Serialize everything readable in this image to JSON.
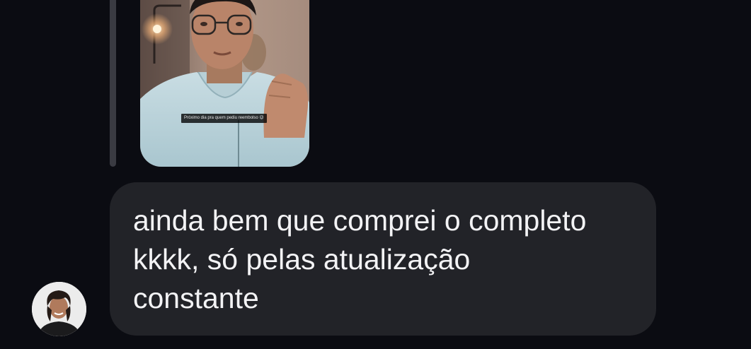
{
  "media": {
    "caption": "Próximo dia pra quem pediu reembolso 😉",
    "icon": "video-thumbnail"
  },
  "message": {
    "lines": [
      "ainda bem que comprei o completo",
      "kkkk, só pelas atualização",
      "constante"
    ]
  },
  "sender": {
    "avatar_icon": "user-avatar"
  },
  "colors": {
    "background": "#0b0c12",
    "bubble": "#222328",
    "text": "#f3f3f5",
    "reply_bar": "#3a3b42"
  }
}
